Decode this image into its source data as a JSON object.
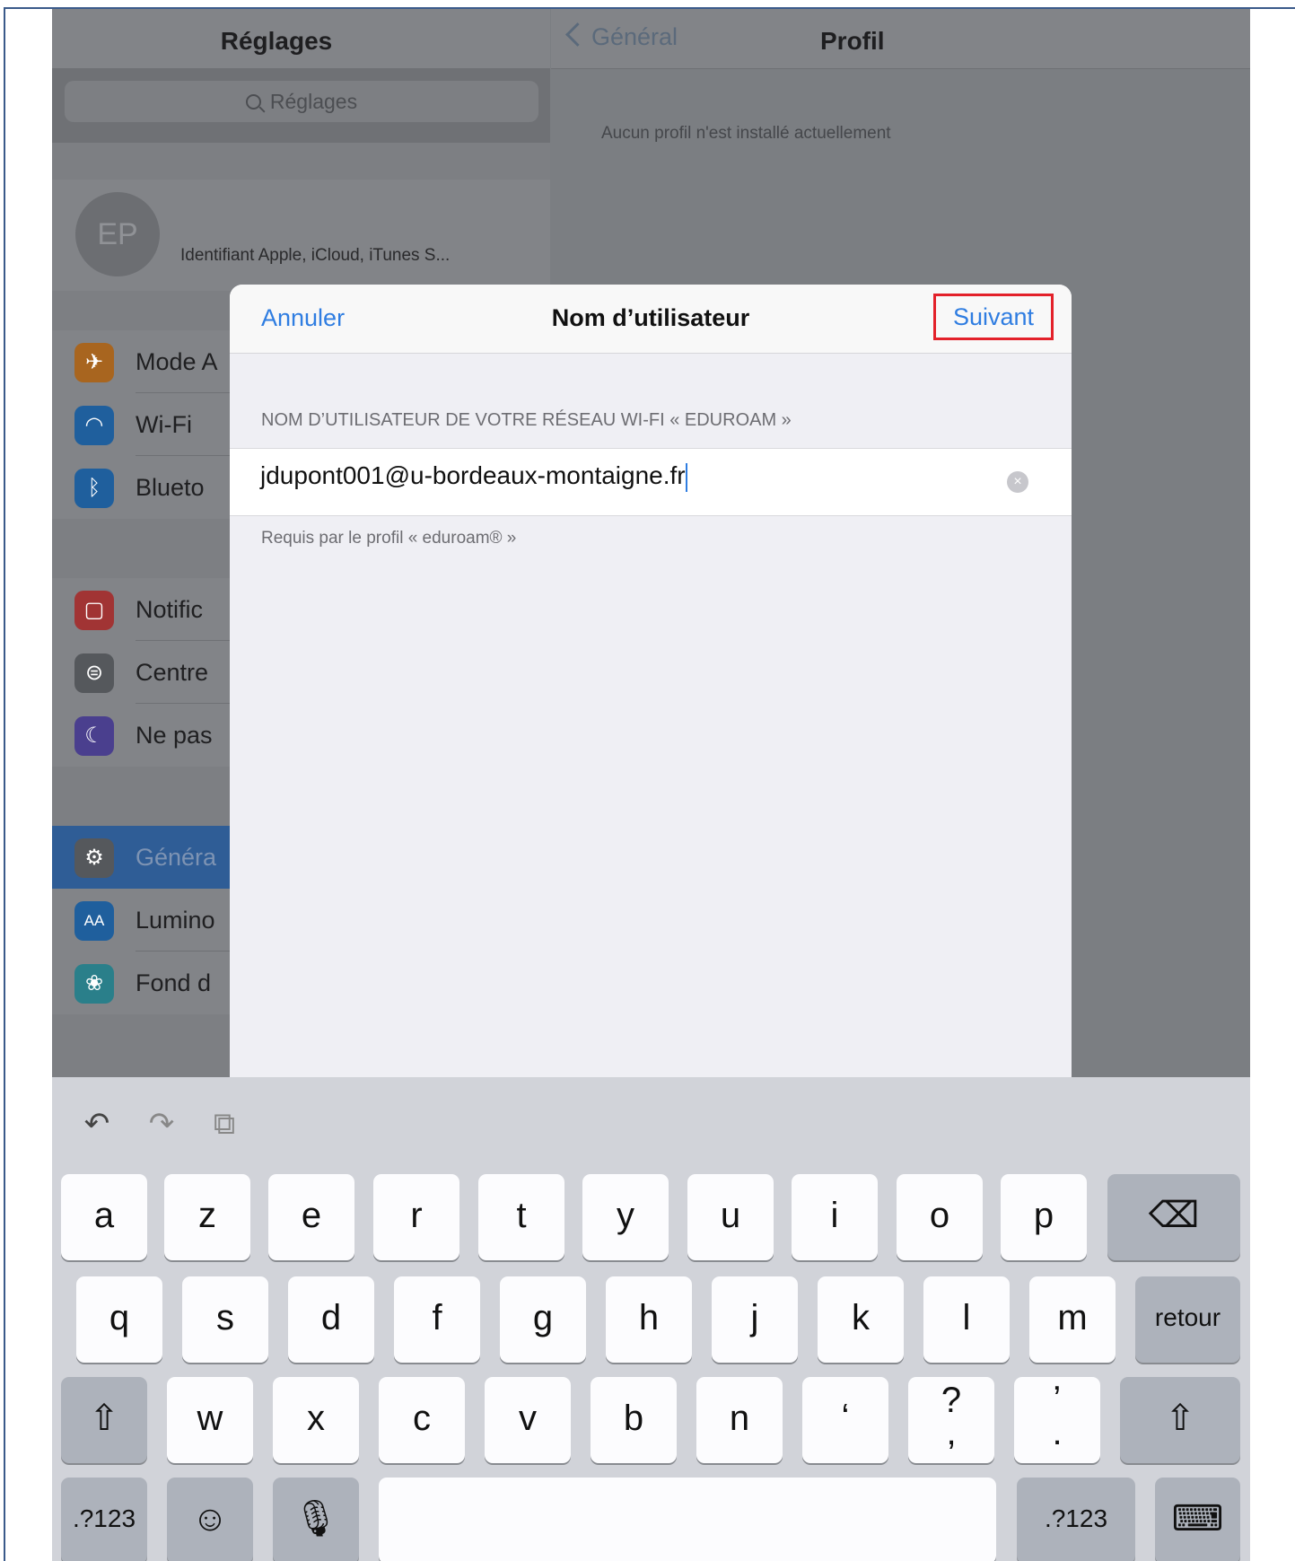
{
  "settings": {
    "title": "Réglages",
    "search_placeholder": "Réglages",
    "profile": {
      "initials": "EP",
      "subtitle": "Identifiant Apple, iCloud, iTunes S..."
    },
    "items": [
      {
        "label": "Mode A",
        "icon": "airplane-icon",
        "color": "#a8651f",
        "glyph": "✈"
      },
      {
        "label": "Wi-Fi",
        "icon": "wifi-icon",
        "color": "#1f5f9d",
        "glyph": "◠"
      },
      {
        "label": "Blueto",
        "icon": "bluetooth-icon",
        "color": "#1f5f9d",
        "glyph": "ᛒ"
      },
      {
        "label": "Notific",
        "icon": "notifications-icon",
        "color": "#a13434",
        "glyph": "▢"
      },
      {
        "label": "Centre",
        "icon": "control-center-icon",
        "color": "#55585c",
        "glyph": "⊜"
      },
      {
        "label": "Ne pas",
        "icon": "moon-icon",
        "color": "#4a3f8e",
        "glyph": "☾"
      },
      {
        "label": "Généra",
        "icon": "gear-icon",
        "color": "#55585c",
        "glyph": "⚙"
      },
      {
        "label": "Lumino",
        "icon": "display-icon",
        "color": "#1f5f9d",
        "glyph": "AA"
      },
      {
        "label": "Fond d",
        "icon": "wallpaper-icon",
        "color": "#2a7f8a",
        "glyph": "❀"
      }
    ]
  },
  "detail": {
    "back_label": "Général",
    "title": "Profil",
    "message": "Aucun profil n'est installé actuellement"
  },
  "modal": {
    "cancel_label": "Annuler",
    "title": "Nom d’utilisateur",
    "next_label": "Suivant",
    "section_header": "NOM D’UTILISATEUR DE VOTRE RÉSEAU WI-FI « EDUROAM »",
    "username_value": "jdupont001@u-bordeaux-montaigne.fr",
    "footnote": "Requis par le profil « eduroam® »"
  },
  "keyboard": {
    "row1": [
      "a",
      "z",
      "e",
      "r",
      "t",
      "y",
      "u",
      "i",
      "o",
      "p"
    ],
    "row2": [
      "q",
      "s",
      "d",
      "f",
      "g",
      "h",
      "j",
      "k",
      "l",
      "m"
    ],
    "return_label": "retour",
    "row3": [
      "w",
      "x",
      "c",
      "v",
      "b",
      "n",
      "ʻ"
    ],
    "question_key": {
      "top": "?",
      "bottom": ","
    },
    "period_key": {
      "top": "ʼ",
      "bottom": "."
    },
    "numbers_label": ".?123"
  }
}
